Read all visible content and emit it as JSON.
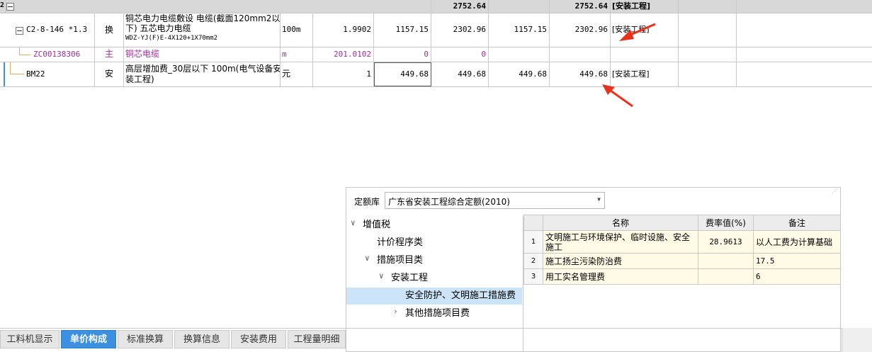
{
  "grid": {
    "summary_row": {
      "index": "2",
      "total_a": "2752.64",
      "total_b": "2752.64",
      "note": "[安装工程]"
    },
    "rows": [
      {
        "code": "C2-8-146 *1.3",
        "type": "换",
        "name_line1": "铜芯电力电缆敷设 电缆(截面120mm2以",
        "name_line2": "下) 五芯电力电缆",
        "name_line3": "WDZ-YJ(F)E-4X120+1X70mm2",
        "unit": "100m",
        "qty": "1.9902",
        "price1": "1157.15",
        "total1": "2302.96",
        "price2": "1157.15",
        "total2": "2302.96",
        "note": "[安装工程]"
      },
      {
        "code": "ZC00138306",
        "type": "主",
        "name_line1": "铜芯电缆",
        "unit": "m",
        "qty": "201.0102",
        "price1": "0",
        "total1": "0"
      },
      {
        "code": "BM22",
        "type": "安",
        "name_line1": "高层增加费_30层以下 100m(电气设备安",
        "name_line2": "装工程)",
        "unit": "元",
        "qty": "1",
        "price1": "449.68",
        "total1": "449.68",
        "price2": "449.68",
        "total2": "449.68",
        "note": "[安装工程]"
      }
    ]
  },
  "panel": {
    "library_label": "定额库",
    "library_value": "广东省安装工程综合定额(2010)",
    "tree": [
      "增值税",
      "计价程序类",
      "措施项目类",
      "安装工程",
      "安全防护、文明施工措施费",
      "其他措施项目费"
    ],
    "table": {
      "headers": [
        "名称",
        "费率值(%)",
        "备注"
      ],
      "rows": [
        {
          "idx": "1",
          "name": "文明施工与环境保护、临时设施、安全施工",
          "rate": "28.9613",
          "note": "以人工费为计算基础"
        },
        {
          "idx": "2",
          "name": "施工扬尘污染防治费",
          "rate": "",
          "note": "17.5"
        },
        {
          "idx": "3",
          "name": "用工实名管理费",
          "rate": "",
          "note": "6"
        }
      ]
    }
  },
  "tabs": [
    "工料机显示",
    "单价构成",
    "标准换算",
    "换算信息",
    "安装费用",
    "工程量明细"
  ],
  "active_tab": "单价构成",
  "colors": {
    "accent": "#3d8fe0",
    "purple": "#9b2f9b",
    "arrow": "#e8321e",
    "selected": "#cce4f7"
  }
}
